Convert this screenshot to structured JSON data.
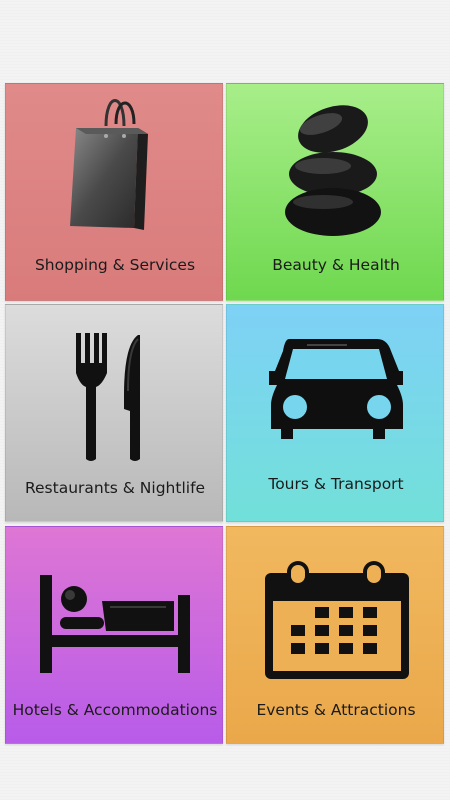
{
  "tiles": [
    {
      "label": "Shopping & Services",
      "icon": "shopping-bag-icon",
      "color": "#dc8282"
    },
    {
      "label": "Beauty & Health",
      "icon": "stacked-stones-icon",
      "color": "#8ee56d"
    },
    {
      "label": "Restaurants & Nightlife",
      "icon": "fork-knife-icon",
      "color": "#c9c9c9"
    },
    {
      "label": "Tours & Transport",
      "icon": "car-icon",
      "color": "#78d9e8"
    },
    {
      "label": "Hotels & Accommodations",
      "icon": "bed-icon",
      "color": "#cb69de"
    },
    {
      "label": "Events & Attractions",
      "icon": "calendar-icon",
      "color": "#eeb055"
    }
  ]
}
